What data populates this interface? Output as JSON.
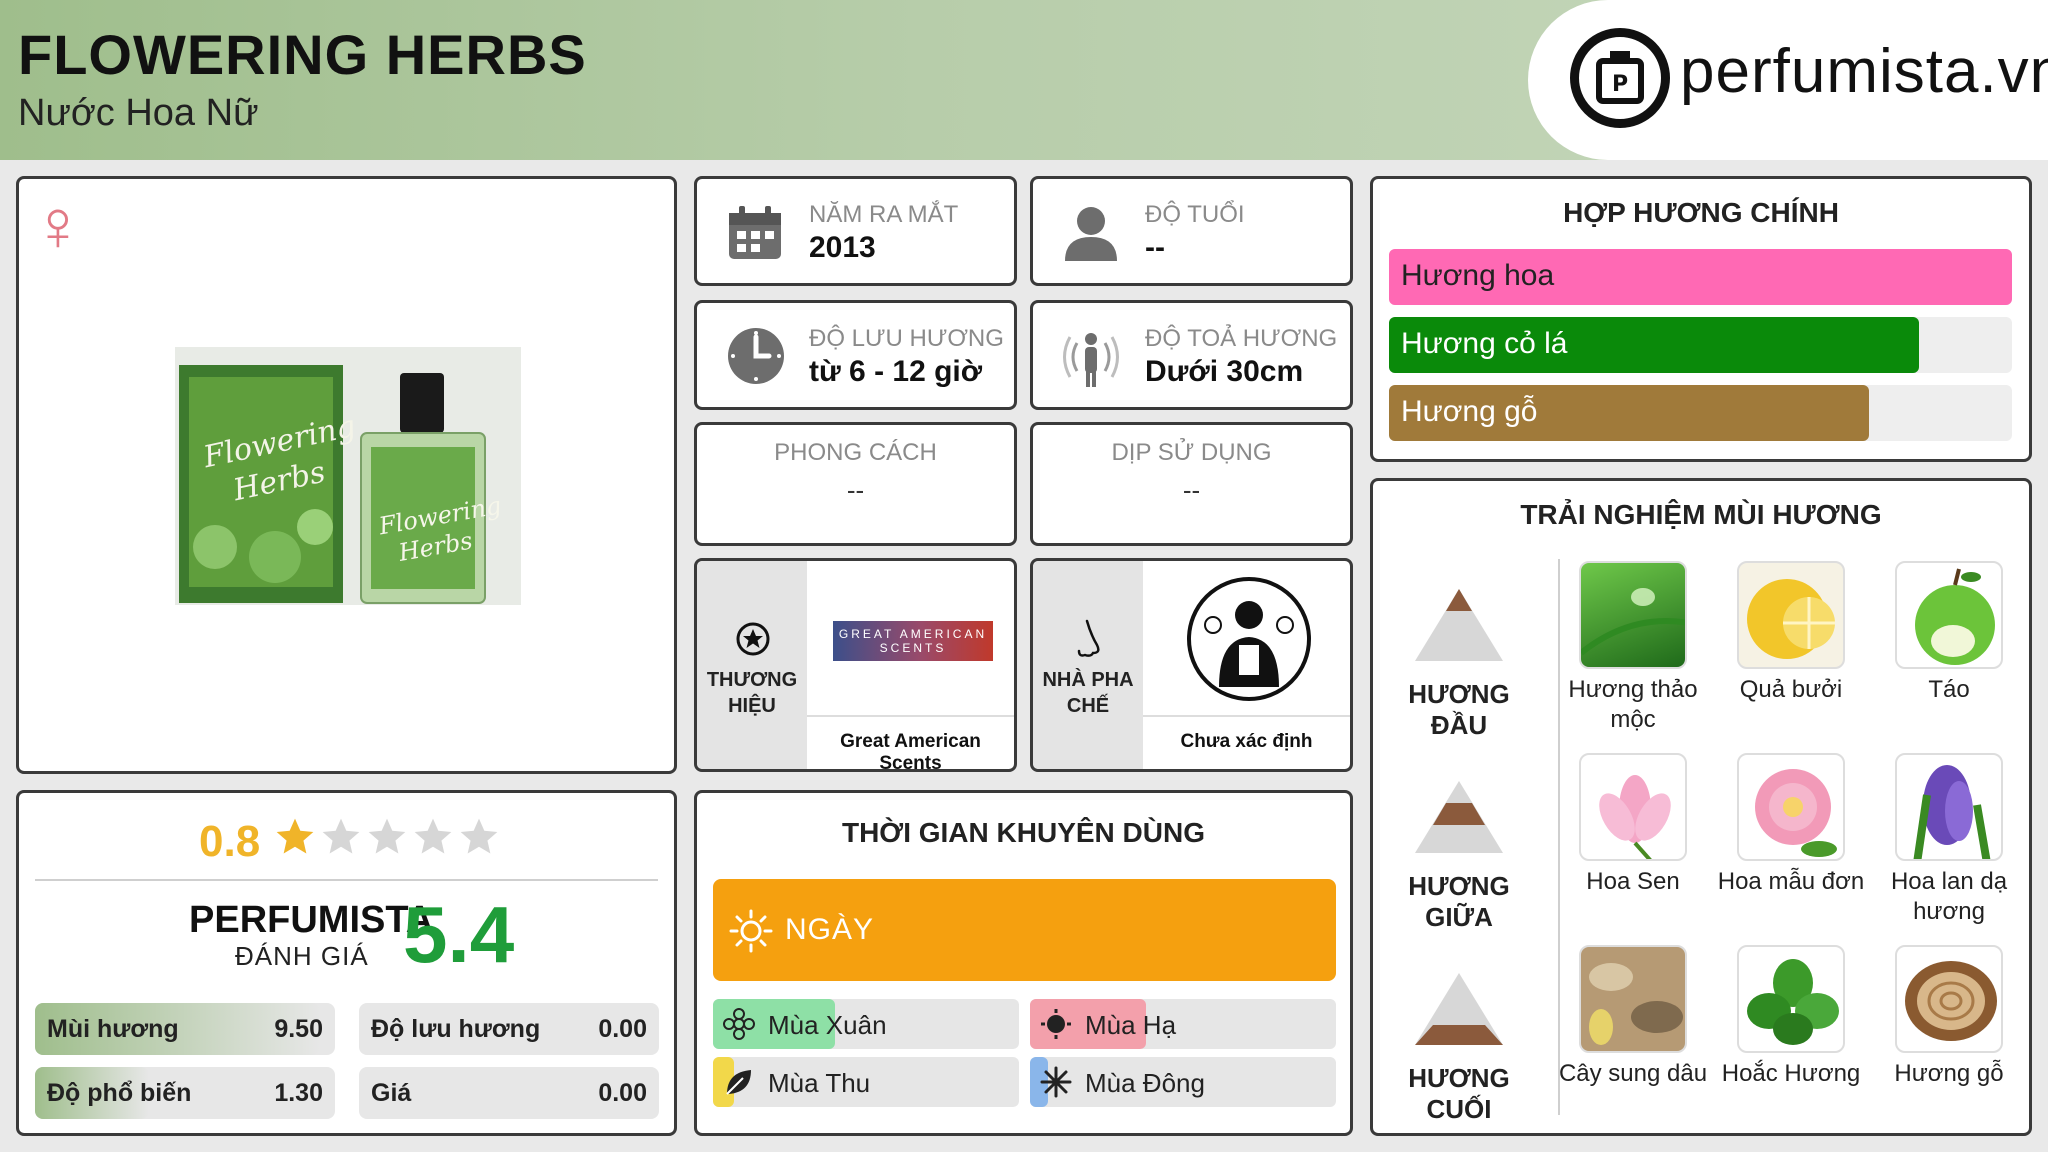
{
  "header": {
    "title": "FLOWERING HERBS",
    "subtitle": "Nước Hoa Nữ",
    "logo_text": "perfumista.vn"
  },
  "gender": {
    "symbol": "♀",
    "color": "#e27a86"
  },
  "info": {
    "year": {
      "label": "NĂM RA MẮT",
      "value": "2013"
    },
    "age": {
      "label": "ĐỘ TUỔI",
      "value": "--"
    },
    "longevity": {
      "label": "ĐỘ LƯU HƯƠNG",
      "value": "từ 6 - 12 giờ"
    },
    "sillage": {
      "label": "ĐỘ TOẢ HƯƠNG",
      "value": "Dưới 30cm"
    },
    "style": {
      "label": "PHONG CÁCH",
      "value": "--"
    },
    "occasion": {
      "label": "DỊP SỬ DỤNG",
      "value": "--"
    }
  },
  "brand": {
    "label_1": "THƯƠNG",
    "label_2": "HIỆU",
    "name": "Great American Scents",
    "logo_line_1": "GREAT AMERICAN",
    "logo_line_2": "SCENTS"
  },
  "perfumer": {
    "label_1": "NHÀ PHA",
    "label_2": "CHẾ",
    "name": "Chưa xác định"
  },
  "rating": {
    "user_score": "0.8",
    "stars_filled": 1,
    "stars_total": 5,
    "perfumista_label": "PERFUMISTA",
    "perfumista_sub": "ĐÁNH GIÁ",
    "perfumista_score": "5.4",
    "scores": [
      {
        "name": "Mùi hương",
        "value": "9.50",
        "fill": 0.95
      },
      {
        "name": "Độ lưu hương",
        "value": "0.00",
        "fill": 0
      },
      {
        "name": "Độ phổ biến",
        "value": "1.30",
        "fill": 0.13
      },
      {
        "name": "Giá",
        "value": "0.00",
        "fill": 0
      }
    ]
  },
  "usage": {
    "title": "THỜI GIAN KHUYÊN DÙNG",
    "day_label": "NGÀY",
    "seasons": [
      {
        "name": "Mùa Xuân",
        "fill": 0.4,
        "color": "#8ee0a6"
      },
      {
        "name": "Mùa Hạ",
        "fill": 0.38,
        "color": "#f3a0ab"
      },
      {
        "name": "Mùa Thu",
        "fill": 0.07,
        "color": "#f2d84a"
      },
      {
        "name": "Mùa Đông",
        "fill": 0.06,
        "color": "#8ab6ea"
      }
    ]
  },
  "accords": {
    "title": "HỢP HƯƠNG CHÍNH",
    "items": [
      {
        "name": "Hương hoa",
        "fill": 1.0,
        "color": "#ff69b4"
      },
      {
        "name": "Hương cỏ lá",
        "fill": 0.85,
        "color": "#0a8a0a"
      },
      {
        "name": "Hương gỗ",
        "fill": 0.77,
        "color": "#a07a3a"
      }
    ]
  },
  "notes": {
    "title": "TRẢI NGHIỆM MÙI HƯƠNG",
    "tiers": [
      {
        "label": "HƯƠNG ĐẦU",
        "items": [
          "Hương thảo mộc",
          "Quả bưởi",
          "Táo"
        ]
      },
      {
        "label": "HƯƠNG GIỮA",
        "items": [
          "Hoa Sen",
          "Hoa mẫu đơn",
          "Hoa lan dạ hương"
        ]
      },
      {
        "label": "HƯƠNG CUỐI",
        "items": [
          "Cây sung dâu",
          "Hoắc Hương",
          "Hương gỗ"
        ]
      }
    ]
  }
}
